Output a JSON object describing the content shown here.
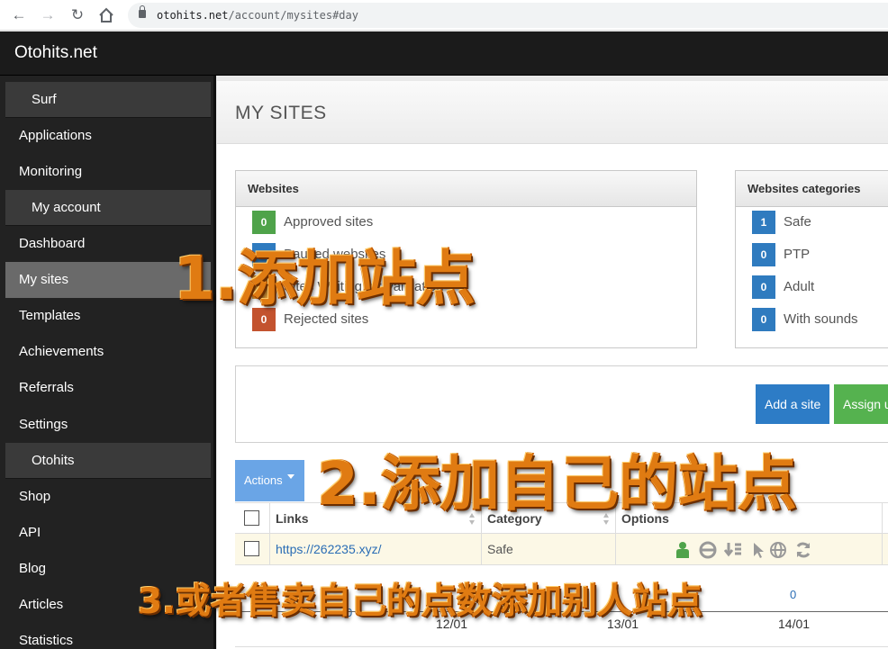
{
  "browser": {
    "url_host": "otohits.net",
    "url_path": "/account/mysites#day"
  },
  "header": {
    "brand": "Otohits.net"
  },
  "sidebar": {
    "items": [
      {
        "label": "Surf",
        "type": "section"
      },
      {
        "label": "Applications",
        "type": "link"
      },
      {
        "label": "Monitoring",
        "type": "link"
      },
      {
        "label": "My account",
        "type": "section"
      },
      {
        "label": "Dashboard",
        "type": "link"
      },
      {
        "label": "My sites",
        "type": "link",
        "active": true
      },
      {
        "label": "Templates",
        "type": "link"
      },
      {
        "label": "Achievements",
        "type": "link"
      },
      {
        "label": "Referrals",
        "type": "link"
      },
      {
        "label": "Settings",
        "type": "link"
      },
      {
        "label": "Otohits",
        "type": "section"
      },
      {
        "label": "Shop",
        "type": "link"
      },
      {
        "label": "API",
        "type": "link"
      },
      {
        "label": "Blog",
        "type": "link"
      },
      {
        "label": "Articles",
        "type": "link"
      },
      {
        "label": "Statistics",
        "type": "link"
      }
    ]
  },
  "main": {
    "title": "MY SITES",
    "websites_panel": {
      "heading": "Websites",
      "stats": [
        {
          "count": "0",
          "label": "Approved sites",
          "color": "#4fa34a"
        },
        {
          "count": "0",
          "label": "Paused websites",
          "color": "#2f7bbf"
        },
        {
          "count": "0",
          "label": "Sites Waiting for Validation",
          "color": "#e8a23a"
        },
        {
          "count": "0",
          "label": "Rejected sites",
          "color": "#c3532f"
        }
      ]
    },
    "categories_panel": {
      "heading": "Websites categories",
      "stats": [
        {
          "count": "1",
          "label": "Safe",
          "color": "#2f7bbf"
        },
        {
          "count": "0",
          "label": "PTP",
          "color": "#2f7bbf"
        },
        {
          "count": "0",
          "label": "Adult",
          "color": "#2f7bbf"
        },
        {
          "count": "0",
          "label": "With sounds",
          "color": "#2f7bbf"
        }
      ]
    },
    "buttons": {
      "add_site": "Add a site",
      "assign": "Assign u"
    },
    "actions_label": "Actions",
    "table": {
      "headers": {
        "links": "Links",
        "category": "Category",
        "options": "Options"
      },
      "rows": [
        {
          "link": "https://262235.xyz/",
          "category": "Safe"
        }
      ],
      "option_icons": [
        "person-icon",
        "browser-icon",
        "download-icon",
        "cursor-icon",
        "globe-icon",
        "refresh-icon"
      ]
    },
    "chart": {
      "x_labels": [
        "12/01",
        "13/01",
        "14/01"
      ],
      "zero_labels": [
        "0",
        "0"
      ]
    }
  },
  "annotations": {
    "step1": "1.添加站点",
    "step2": "2.添加自己的站点",
    "step3": "3.或者售卖自己的点数添加别人站点"
  },
  "colors": {
    "accent": "#2d7cc6",
    "success": "#55b24f",
    "sidebar": "#222222",
    "overlay": "#e07b12"
  }
}
